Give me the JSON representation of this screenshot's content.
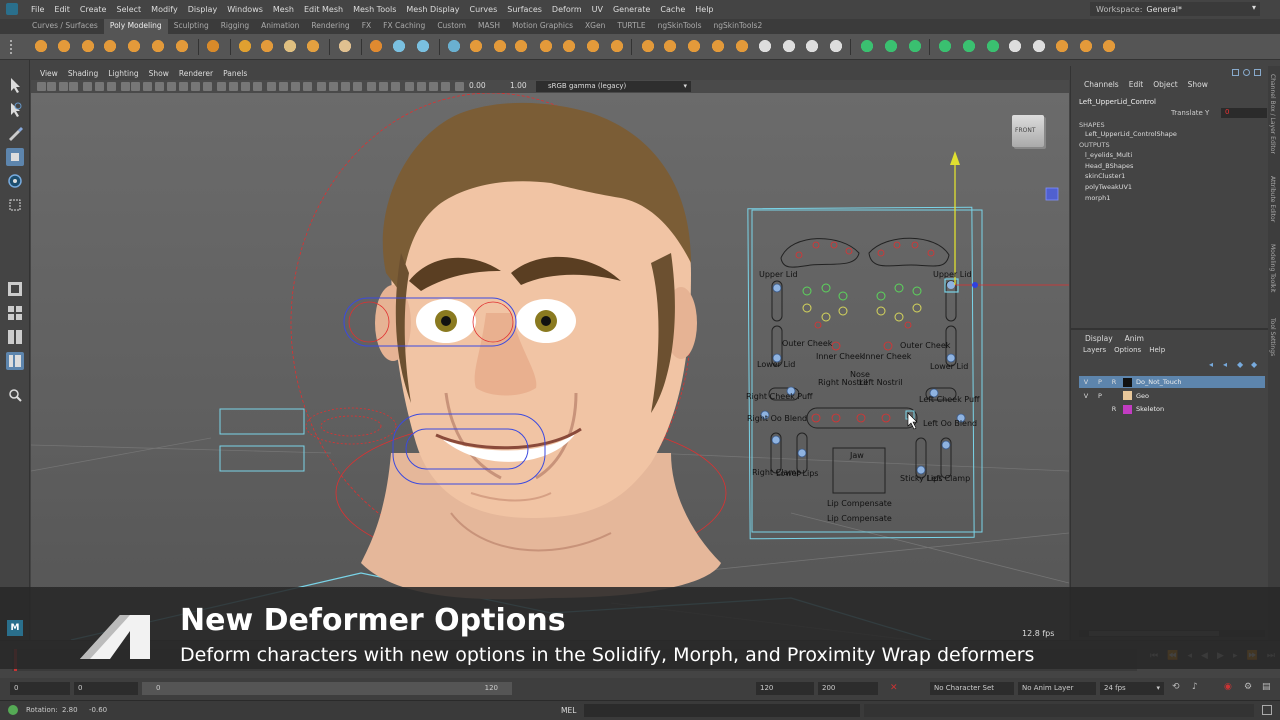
{
  "menu": [
    "File",
    "Edit",
    "Create",
    "Select",
    "Modify",
    "Display",
    "Windows",
    "Mesh",
    "Edit Mesh",
    "Mesh Tools",
    "Mesh Display",
    "Curves",
    "Surfaces",
    "Deform",
    "UV",
    "Generate",
    "Cache",
    "Help"
  ],
  "workspace": {
    "label": "Workspace:",
    "value": "General*"
  },
  "shelf_tabs": [
    "Curves / Surfaces",
    "Poly Modeling",
    "Sculpting",
    "Rigging",
    "Animation",
    "Rendering",
    "FX",
    "FX Caching",
    "Custom",
    "MASH",
    "Motion Graphics",
    "XGen",
    "TURTLE",
    "ngSkinTools",
    "ngSkinTools2"
  ],
  "shelf_active": "Poly Modeling",
  "viewport_menu": [
    "View",
    "Shading",
    "Lighting",
    "Show",
    "Renderer",
    "Panels"
  ],
  "viewport_toolbar": {
    "exposure": "0.00",
    "gamma": "1.00",
    "color_space": "sRGB gamma (legacy)"
  },
  "viewcube_label": "FRONT",
  "face_controls": {
    "labels": [
      "Upper Lid",
      "Upper Lid",
      "Outer Cheek",
      "Outer Cheek",
      "Inner Cheek",
      "Inner Cheek",
      "Lower Lid",
      "Lower Lid",
      "Nose",
      "Right Nostril",
      "Left Nostril",
      "Right Cheek Puff",
      "Left Cheek Puff",
      "Right Oo Blend",
      "Left Oo Blend",
      "Jaw",
      "Right Clamp",
      "Lower Lips",
      "Sticky Lips",
      "Left Clamp",
      "Lip Compensate",
      "Lip Compensate"
    ]
  },
  "channel_box": {
    "menus": [
      "Channels",
      "Edit",
      "Object",
      "Show"
    ],
    "node": "Left_UpperLid_Control",
    "attribute": "Translate Y",
    "attribute_value": "0",
    "shapes_header": "SHAPES",
    "shapes": [
      "Left_UpperLid_ControlShape"
    ],
    "outputs_header": "OUTPUTS",
    "outputs": [
      "l_eyelids_Multi",
      "Head_BShapes",
      "skinCluster1",
      "polyTweakUV1",
      "morph1"
    ]
  },
  "layer_editor": {
    "tabs": [
      "Display",
      "Anim"
    ],
    "menus": [
      "Layers",
      "Options",
      "Help"
    ],
    "layers": [
      {
        "v": "V",
        "p": "P",
        "r": "R",
        "name": "Do_Not_Touch",
        "color": "#111111",
        "selected": true
      },
      {
        "v": "V",
        "p": "P",
        "r": "",
        "name": "Geo",
        "color": "#e8c79a",
        "selected": false
      },
      {
        "v": "",
        "p": "",
        "r": "R",
        "name": "Skeleton",
        "color": "#c23cc2",
        "selected": false
      }
    ]
  },
  "side_tabs": [
    "Channel Box / Layer Editor",
    "Attribute Editor",
    "Modeling Toolkit",
    "Tool Settings"
  ],
  "timeline": {
    "current": "0",
    "start": "0",
    "range_start": "0",
    "range_end": "120",
    "end_a": "120",
    "end_b": "200",
    "character_set": "No Character Set",
    "anim_layer": "No Anim Layer",
    "fps_setting": "24 fps"
  },
  "command_line": {
    "status": "Rotation:",
    "x": "2.80",
    "y": "-0.60",
    "lang": "MEL"
  },
  "overlay": {
    "title": "New Deformer Options",
    "subtitle": "Deform characters with new options in the Solidify, Morph, and Proximity Wrap deformers",
    "fps": "12.8 fps"
  }
}
